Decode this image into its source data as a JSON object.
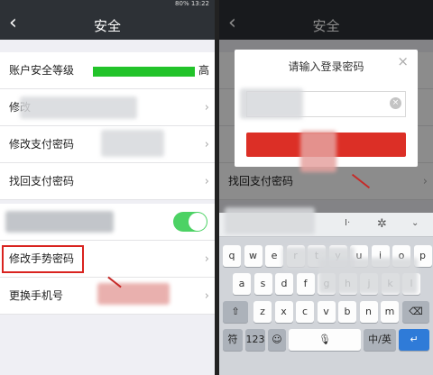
{
  "left_screen": {
    "status": "80% 13:22",
    "title": "安全",
    "rows": {
      "account_level": "账户安全等级",
      "level_value": "高",
      "change_prefix": "修改",
      "change_pay": "修改支付密码",
      "recover_pay": "找回支付密码",
      "change_gesture": "修改手势密码",
      "change_phone": "更换手机号"
    }
  },
  "right_screen": {
    "title": "安全",
    "dialog_title": "请输入登录密码",
    "recover_pay": "找回支付密码",
    "keyboard": {
      "row1": [
        "q",
        "w",
        "e",
        "r",
        "t",
        "y",
        "u",
        "i",
        "o",
        "p"
      ],
      "row2": [
        "a",
        "s",
        "d",
        "f",
        "g",
        "h",
        "j",
        "k",
        "l"
      ],
      "row3": [
        "z",
        "x",
        "c",
        "v",
        "b",
        "n",
        "m"
      ],
      "sym": "符",
      "num": "123",
      "lang": "中/英"
    }
  }
}
